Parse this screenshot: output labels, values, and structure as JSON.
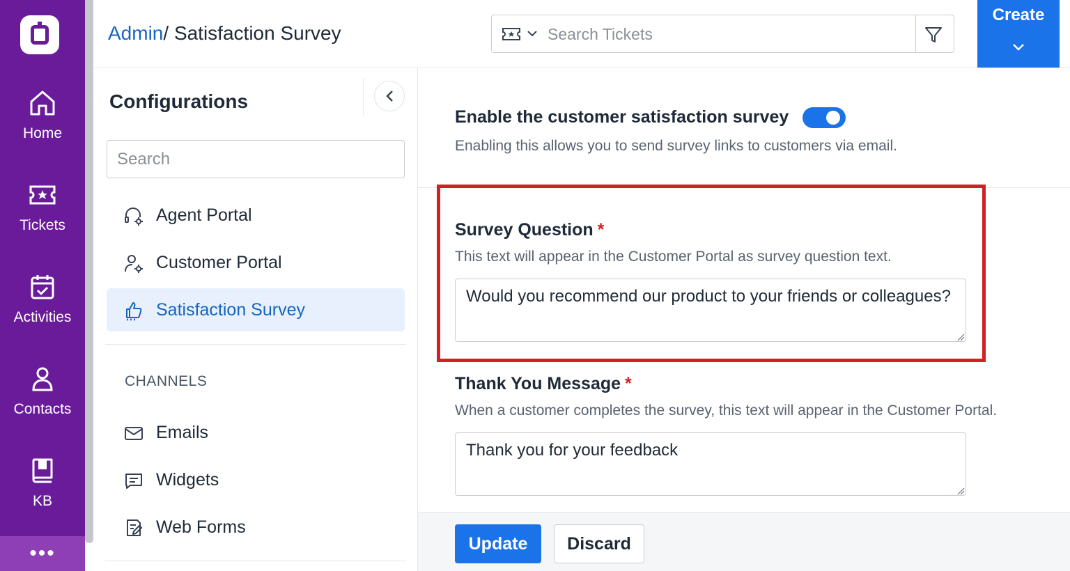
{
  "rail": {
    "items": [
      {
        "label": "Home",
        "icon": "home-icon"
      },
      {
        "label": "Tickets",
        "icon": "ticket-icon"
      },
      {
        "label": "Activities",
        "icon": "calendar-check-icon"
      },
      {
        "label": "Contacts",
        "icon": "user-icon"
      },
      {
        "label": "KB",
        "icon": "book-icon"
      }
    ],
    "more_label": "•••"
  },
  "header": {
    "breadcrumb_link": "Admin",
    "breadcrumb_sep": "/ ",
    "breadcrumb_current": "Satisfaction Survey",
    "search_placeholder": "Search Tickets",
    "create_label": "Create"
  },
  "config": {
    "title": "Configurations",
    "search_placeholder": "Search",
    "items": [
      {
        "label": "Agent Portal",
        "icon": "headset-gear-icon"
      },
      {
        "label": "Customer Portal",
        "icon": "user-gear-icon"
      },
      {
        "label": "Satisfaction Survey",
        "icon": "thumbs-up-icon",
        "active": true
      }
    ],
    "section_label": "CHANNELS",
    "channels": [
      {
        "label": "Emails",
        "icon": "mail-icon"
      },
      {
        "label": "Widgets",
        "icon": "chat-icon"
      },
      {
        "label": "Web Forms",
        "icon": "form-icon"
      }
    ]
  },
  "main": {
    "enable_title": "Enable the customer satisfaction survey",
    "enable_desc": "Enabling this allows you to send survey links to customers via email.",
    "enabled": true,
    "question_title": "Survey Question",
    "question_desc": "This text will appear in the Customer Portal as survey question text.",
    "question_value": "Would you recommend our product to your friends or colleagues?",
    "thanks_title": "Thank You Message",
    "thanks_desc": "When a customer completes the survey, this text will appear in the Customer Portal.",
    "thanks_value": "Thank you for your feedback",
    "required_mark": "*",
    "update_label": "Update",
    "discard_label": "Discard"
  },
  "colors": {
    "rail": "#6a1b9a",
    "accent": "#1a73e8",
    "highlight": "#d32027"
  }
}
